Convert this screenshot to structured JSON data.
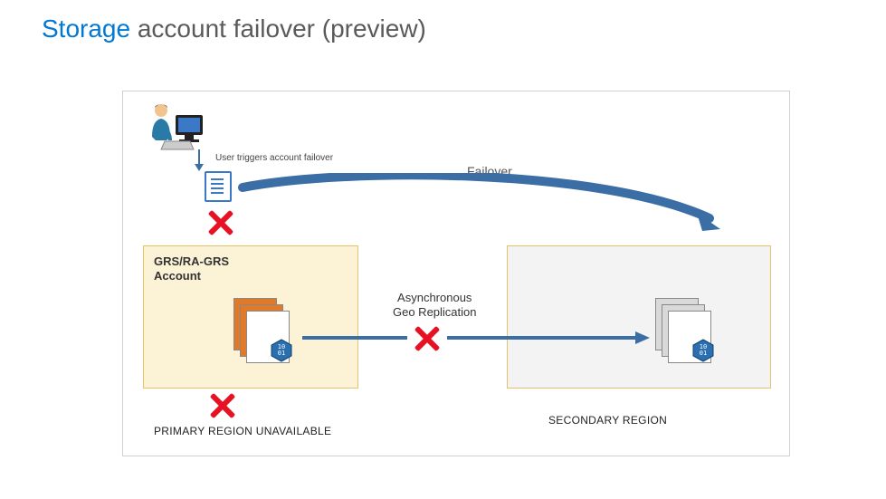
{
  "title": {
    "prefix": "Storage ",
    "rest": "account failover (preview)"
  },
  "trigger_label": "User triggers account failover",
  "failover_label": "Failover",
  "primary_account_label": "GRS/RA-GRS\nAccount",
  "async_label": "Asynchronous\nGeo Replication",
  "primary_region_label": "PRIMARY REGION UNAVAILABLE",
  "secondary_region_label": "SECONDARY REGION",
  "hex_text": "10\n01",
  "colors": {
    "accent_blue": "#0078d4",
    "arrow_blue": "#3a6ea5",
    "x_red": "#e81123",
    "primary_fill": "#fcf2d6",
    "secondary_fill": "#f3f3f3",
    "box_border": "#e6c36a",
    "card_orange": "#e07a2a"
  },
  "icons": {
    "user": "user-at-computer-icon",
    "document": "document-icon",
    "storage_hex": "storage-hex-icon",
    "x": "x-mark-icon"
  }
}
